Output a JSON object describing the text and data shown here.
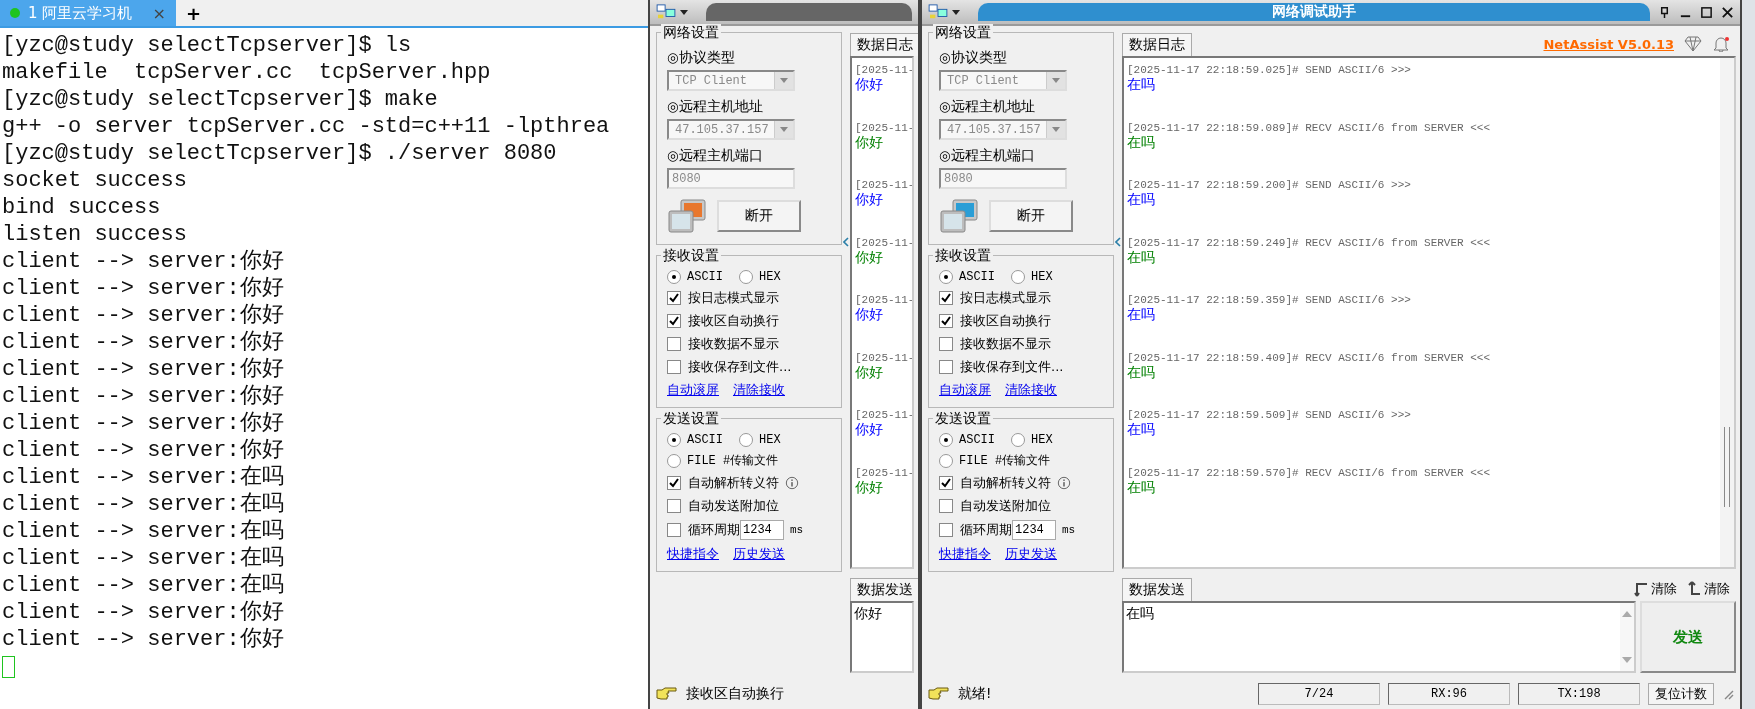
{
  "terminal": {
    "tabs": [
      {
        "label": "1 阿里云学习机",
        "selected": true,
        "close": "×"
      }
    ],
    "new_tab": "+",
    "lines": [
      "[yzc@study selectTcpserver]$ ls",
      "makefile  tcpServer.cc  tcpServer.hpp",
      "[yzc@study selectTcpserver]$ make",
      "g++ -o server tcpServer.cc -std=c++11 -lpthrea",
      "[yzc@study selectTcpserver]$ ./server 8080",
      "socket success",
      "bind success",
      "listen success",
      "client --> server:你好",
      "client --> server:你好",
      "client --> server:你好",
      "client --> server:你好",
      "client --> server:你好",
      "client --> server:你好",
      "client --> server:你好",
      "client --> server:你好",
      "client --> server:在吗",
      "client --> server:在吗",
      "client --> server:在吗",
      "client --> server:在吗",
      "client --> server:在吗",
      "client --> server:你好",
      "client --> server:你好"
    ]
  },
  "windows": [
    {
      "log_tab": "数据日志",
      "groups": [
        {
          "title": "网络设置",
          "items": [
            {
              "kind": "select",
              "label": "◎协议类型",
              "value": "TCP Client",
              "disabled": true
            },
            {
              "kind": "select",
              "label": "◎远程主机地址",
              "value": "47.105.37.157",
              "disabled": true
            },
            {
              "kind": "input",
              "label": "◎远程主机端口",
              "value": "8080",
              "disabled": true
            },
            {
              "kind": "connect",
              "button": "断开",
              "color": "#e8772e"
            }
          ]
        },
        {
          "title": "接收设置",
          "items": [
            {
              "kind": "radios",
              "options": [
                {
                  "label": "ASCII",
                  "selected": true
                },
                {
                  "label": "HEX",
                  "selected": false
                }
              ]
            },
            {
              "kind": "checkbox",
              "label": "按日志模式显示",
              "checked": true
            },
            {
              "kind": "checkbox",
              "label": "接收区自动换行",
              "checked": true
            },
            {
              "kind": "checkbox",
              "label": "接收数据不显示",
              "checked": false
            },
            {
              "kind": "checkbox",
              "label": "接收保存到文件...",
              "checked": false
            },
            {
              "kind": "links",
              "links": [
                "自动滚屏",
                "清除接收"
              ]
            }
          ]
        },
        {
          "title": "发送设置",
          "items": [
            {
              "kind": "radios",
              "options": [
                {
                  "label": "ASCII",
                  "selected": true
                },
                {
                  "label": "HEX",
                  "selected": false
                }
              ]
            },
            {
              "kind": "radios",
              "options": [
                {
                  "label": "FILE #传输文件",
                  "selected": false
                }
              ]
            },
            {
              "kind": "checkbox",
              "label": "自动解析转义符",
              "checked": true,
              "info": true
            },
            {
              "kind": "checkbox",
              "label": "自动发送附加位",
              "checked": false
            },
            {
              "kind": "cycle",
              "label": "循环周期",
              "checked": false,
              "value": "1234",
              "unit": "ms"
            },
            {
              "kind": "links",
              "links": [
                "快捷指令",
                "历史发送"
              ]
            }
          ]
        }
      ],
      "log": [
        {
          "kind": "send",
          "stamp": "[2025-11-",
          "text": "你好"
        },
        {
          "kind": "recv",
          "stamp": "[2025-11-",
          "text": "你好"
        },
        {
          "kind": "send",
          "stamp": "[2025-11-",
          "text": "你好"
        },
        {
          "kind": "recv",
          "stamp": "[2025-11-",
          "text": "你好"
        },
        {
          "kind": "send",
          "stamp": "[2025-11-",
          "text": "你好"
        },
        {
          "kind": "recv",
          "stamp": "[2025-11-",
          "text": "你好"
        },
        {
          "kind": "send",
          "stamp": "[2025-11-",
          "text": "你好"
        },
        {
          "kind": "recv",
          "stamp": "[2025-11-",
          "text": "你好"
        }
      ],
      "send_tab": "数据发送",
      "send_text": "你好",
      "status": {
        "message": "接收区自动换行"
      }
    },
    {
      "title": "网络调试助手",
      "version": "NetAssist V5.0.13",
      "log_tab": "数据日志",
      "groups": [
        {
          "title": "网络设置",
          "items": [
            {
              "kind": "select",
              "label": "◎协议类型",
              "value": "TCP Client",
              "disabled": true
            },
            {
              "kind": "select",
              "label": "◎远程主机地址",
              "value": "47.105.37.157",
              "disabled": true
            },
            {
              "kind": "input",
              "label": "◎远程主机端口",
              "value": "8080",
              "disabled": true
            },
            {
              "kind": "connect",
              "button": "断开",
              "color": "#2a9ed6"
            }
          ]
        },
        {
          "title": "接收设置",
          "items": [
            {
              "kind": "radios",
              "options": [
                {
                  "label": "ASCII",
                  "selected": true
                },
                {
                  "label": "HEX",
                  "selected": false
                }
              ]
            },
            {
              "kind": "checkbox",
              "label": "按日志模式显示",
              "checked": true
            },
            {
              "kind": "checkbox",
              "label": "接收区自动换行",
              "checked": true
            },
            {
              "kind": "checkbox",
              "label": "接收数据不显示",
              "checked": false
            },
            {
              "kind": "checkbox",
              "label": "接收保存到文件...",
              "checked": false
            },
            {
              "kind": "links",
              "links": [
                "自动滚屏",
                "清除接收"
              ]
            }
          ]
        },
        {
          "title": "发送设置",
          "items": [
            {
              "kind": "radios",
              "options": [
                {
                  "label": "ASCII",
                  "selected": true
                },
                {
                  "label": "HEX",
                  "selected": false
                }
              ]
            },
            {
              "kind": "radios",
              "options": [
                {
                  "label": "FILE #传输文件",
                  "selected": false
                }
              ]
            },
            {
              "kind": "checkbox",
              "label": "自动解析转义符",
              "checked": true,
              "info": true
            },
            {
              "kind": "checkbox",
              "label": "自动发送附加位",
              "checked": false
            },
            {
              "kind": "cycle",
              "label": "循环周期",
              "checked": false,
              "value": "1234",
              "unit": "ms"
            },
            {
              "kind": "links",
              "links": [
                "快捷指令",
                "历史发送"
              ]
            }
          ]
        }
      ],
      "log": [
        {
          "kind": "send",
          "stamp": "[2025-11-17 22:18:59.025]# SEND ASCII/6 >>>",
          "text": "在吗"
        },
        {
          "kind": "recv",
          "stamp": "[2025-11-17 22:18:59.089]# RECV ASCII/6 from SERVER <<<",
          "text": "在吗"
        },
        {
          "kind": "send",
          "stamp": "[2025-11-17 22:18:59.200]# SEND ASCII/6 >>>",
          "text": "在吗"
        },
        {
          "kind": "recv",
          "stamp": "[2025-11-17 22:18:59.249]# RECV ASCII/6 from SERVER <<<",
          "text": "在吗"
        },
        {
          "kind": "send",
          "stamp": "[2025-11-17 22:18:59.359]# SEND ASCII/6 >>>",
          "text": "在吗"
        },
        {
          "kind": "recv",
          "stamp": "[2025-11-17 22:18:59.409]# RECV ASCII/6 from SERVER <<<",
          "text": "在吗"
        },
        {
          "kind": "send",
          "stamp": "[2025-11-17 22:18:59.509]# SEND ASCII/6 >>>",
          "text": "在吗"
        },
        {
          "kind": "recv",
          "stamp": "[2025-11-17 22:18:59.570]# RECV ASCII/6 from SERVER <<<",
          "text": "在吗"
        }
      ],
      "send_tab": "数据发送",
      "clear_buttons": [
        "清除",
        "清除"
      ],
      "send_text": "在吗",
      "send_button": "发送",
      "status": {
        "message": "就绪!",
        "counters": [
          "7/24",
          "RX:96",
          "TX:198"
        ],
        "reset": "复位计数"
      }
    }
  ]
}
